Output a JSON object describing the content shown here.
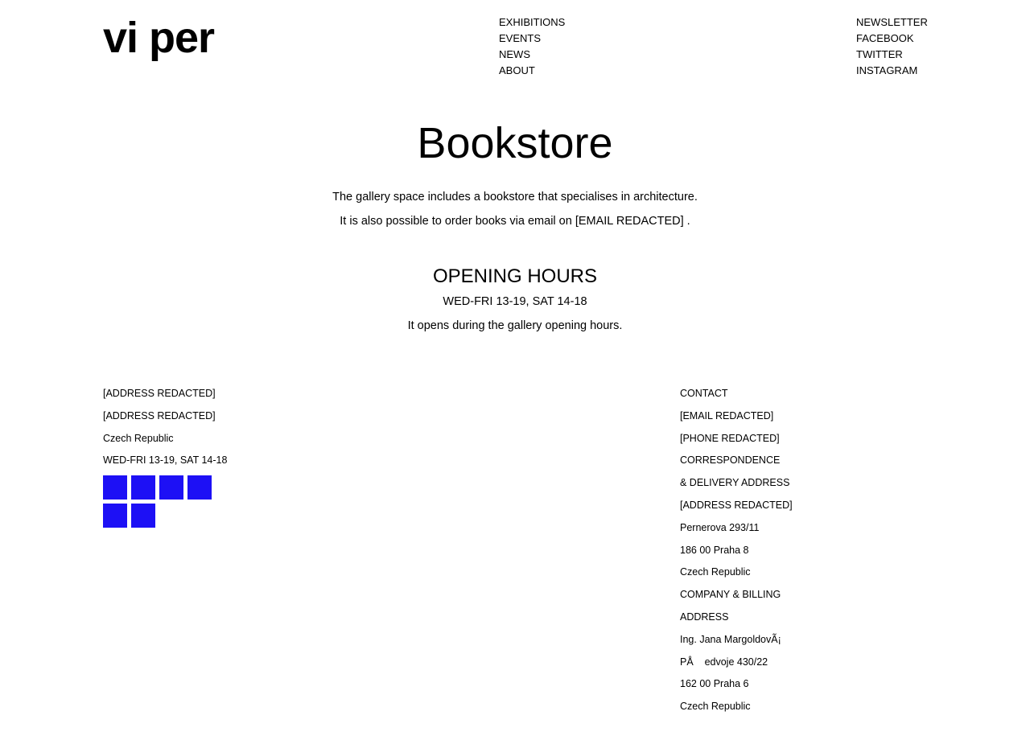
{
  "header": {
    "logo": "vi per",
    "nav": [
      "EXHIBITIONS",
      "EVENTS",
      "NEWS",
      "ABOUT"
    ],
    "social": [
      "NEWSLETTER",
      "FACEBOOK",
      "TWITTER",
      "INSTAGRAM"
    ]
  },
  "main": {
    "title": "Bookstore",
    "intro": [
      "The gallery space includes a bookstore that specialises in architecture.",
      "It is also possible to order books via email on [EMAIL REDACTED] ."
    ],
    "hours": {
      "heading": "OPENING HOURS",
      "times": "WED-FRI 13-19, SAT 14-18",
      "note": "It opens during the gallery opening hours."
    }
  },
  "footer": {
    "left": [
      "[ADDRESS REDACTED]",
      "[ADDRESS REDACTED]",
      "Czech Republic",
      "WED-FRI 13-19, SAT 14-18"
    ],
    "icons": [
      "social-icon-1",
      "social-icon-2",
      "social-icon-3",
      "social-icon-4",
      "social-icon-5",
      "social-icon-6"
    ],
    "right": [
      "CONTACT",
      "[EMAIL REDACTED]",
      "[PHONE REDACTED]",
      "CORRESPONDENCE",
      "& DELIVERY ADDRESS",
      "[ADDRESS REDACTED]",
      "Pernerova 293/11",
      "186 00 Praha 8",
      "Czech Republic",
      "COMPANY & BILLING",
      "ADDRESS",
      "Ing. Jana MargoldovÃ¡",
      "PÅ    edvoje 430/22",
      "162 00 Praha 6",
      "Czech Republic"
    ]
  },
  "colors": {
    "icon": "#1d10f5",
    "text": "#000000",
    "background": "#ffffff"
  }
}
